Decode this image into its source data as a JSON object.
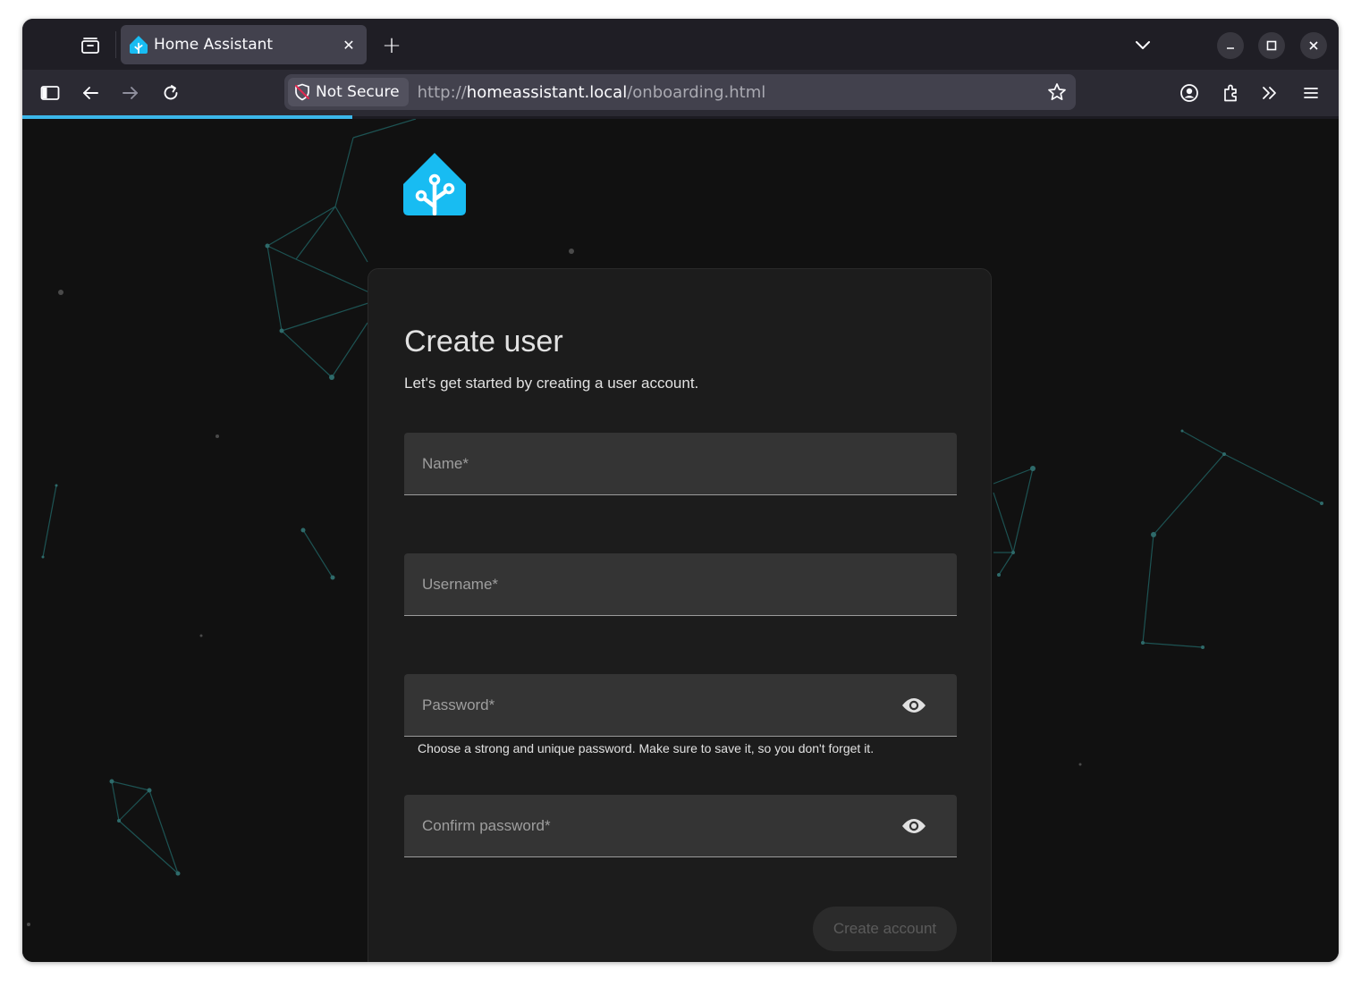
{
  "browser": {
    "tab": {
      "title": "Home Assistant",
      "close_glyph": "✕"
    },
    "new_tab_glyph": "+",
    "url": {
      "security_label": "Not Secure",
      "scheme": "http://",
      "host": "homeassistant.local",
      "path": "/onboarding.html"
    },
    "icons": {
      "tab_list": "tab-list-icon",
      "tabs_overflow": "chevron-down-icon",
      "minimize": "minimize-icon",
      "maximize": "maximize-icon",
      "close": "close-icon",
      "sidebar": "sidebar-icon",
      "back": "back-arrow-icon",
      "forward": "forward-arrow-icon",
      "reload": "reload-icon",
      "shield": "shield-icon",
      "bookmark": "star-icon",
      "account": "account-icon",
      "extensions": "puzzle-icon",
      "overflow": "double-chevron-icon",
      "menu": "hamburger-menu-icon"
    },
    "accent_color": "#3bb7ea"
  },
  "onboarding": {
    "logo": "home-assistant-logo",
    "brand_color": "#18bcf2",
    "title": "Create user",
    "subtitle": "Let's get started by creating a user account.",
    "fields": {
      "name": {
        "label": "Name*",
        "value": ""
      },
      "username": {
        "label": "Username*",
        "value": ""
      },
      "password": {
        "label": "Password*",
        "value": ""
      },
      "confirm_password": {
        "label": "Confirm password*",
        "value": ""
      }
    },
    "password_helper": "Choose a strong and unique password. Make sure to save it, so you don't forget it.",
    "submit_label": "Create account",
    "submit_disabled": true
  }
}
